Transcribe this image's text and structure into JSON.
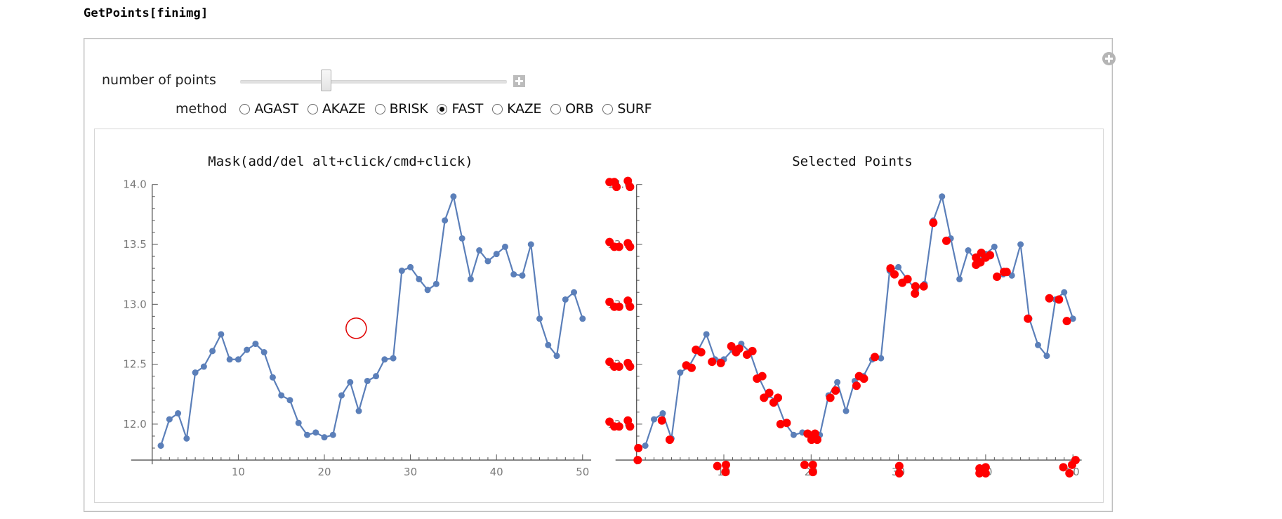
{
  "input_expression": "GetPoints[finimg]",
  "controls": {
    "slider": {
      "label": "number of points",
      "value_fraction": 0.32
    },
    "method": {
      "label": "method",
      "options": [
        "AGAST",
        "AKAZE",
        "BRISK",
        "FAST",
        "KAZE",
        "ORB",
        "SURF"
      ],
      "selected": "FAST"
    }
  },
  "icons": {
    "panel_corner": "plus-circle-icon",
    "slider_expand": "plus-square-icon"
  },
  "colors": {
    "series": "#5b7fb9",
    "selected_points": "#ff0000",
    "mask_circle": "#e00000",
    "axis": "#555555",
    "panel_border": "#bdbdbd"
  },
  "chart_data": [
    {
      "type": "line",
      "title": "Mask(add/del alt+click/cmd+click)",
      "xlabel": "",
      "ylabel": "",
      "xlim": [
        0,
        51
      ],
      "ylim": [
        11.7,
        14.0
      ],
      "x_ticks": [
        10,
        20,
        30,
        40,
        50
      ],
      "y_ticks": [
        "12.0",
        "12.5",
        "13.0",
        "13.5",
        "14.0"
      ],
      "grid": false,
      "x": [
        1,
        2,
        3,
        4,
        5,
        6,
        7,
        8,
        9,
        10,
        11,
        12,
        13,
        14,
        15,
        16,
        17,
        18,
        19,
        20,
        21,
        22,
        23,
        24,
        25,
        26,
        27,
        28,
        29,
        30,
        31,
        32,
        33,
        34,
        35,
        36,
        37,
        38,
        39,
        40,
        41,
        42,
        43,
        44,
        45,
        46,
        47,
        48,
        49,
        50
      ],
      "values": [
        11.82,
        12.04,
        12.09,
        11.88,
        12.43,
        12.48,
        12.61,
        12.75,
        12.54,
        12.54,
        12.62,
        12.67,
        12.6,
        12.39,
        12.24,
        12.2,
        12.01,
        11.91,
        11.93,
        11.89,
        11.91,
        12.24,
        12.35,
        12.11,
        12.36,
        12.4,
        12.54,
        12.55,
        13.28,
        13.31,
        13.21,
        13.12,
        13.17,
        13.7,
        13.9,
        13.55,
        13.21,
        13.45,
        13.36,
        13.42,
        13.48,
        13.25,
        13.24,
        13.5,
        12.88,
        12.66,
        12.57,
        13.04,
        13.1,
        12.88
      ],
      "mask_circles": [
        {
          "x": 23.7,
          "y": 12.8
        }
      ]
    },
    {
      "type": "scatter",
      "title": "Selected Points",
      "xlabel": "",
      "ylabel": "",
      "xlim": [
        0,
        51
      ],
      "ylim": [
        11.7,
        14.0
      ],
      "x_ticks": [
        10,
        20,
        30,
        40,
        50
      ],
      "y_ticks": [
        "12.0",
        "12.5",
        "13.0",
        "13.5",
        "14.0"
      ],
      "grid": false,
      "base_series": "same as Mask plot",
      "points": [
        [
          0.2,
          11.8
        ],
        [
          0.13,
          11.7
        ],
        [
          2.9,
          12.03
        ],
        [
          3.8,
          11.87
        ],
        [
          5.7,
          12.49
        ],
        [
          6.3,
          12.47
        ],
        [
          6.8,
          12.62
        ],
        [
          7.4,
          12.6
        ],
        [
          8.65,
          12.52
        ],
        [
          9.65,
          12.51
        ],
        [
          10.86,
          12.65
        ],
        [
          11.4,
          12.6
        ],
        [
          11.75,
          12.63
        ],
        [
          12.65,
          12.58
        ],
        [
          13.27,
          12.61
        ],
        [
          13.8,
          12.38
        ],
        [
          14.4,
          12.4
        ],
        [
          14.6,
          12.22
        ],
        [
          15.2,
          12.26
        ],
        [
          15.7,
          12.18
        ],
        [
          16.2,
          12.22
        ],
        [
          16.5,
          12.0
        ],
        [
          17.2,
          12.01
        ],
        [
          19.6,
          11.92
        ],
        [
          20.05,
          11.87
        ],
        [
          20.45,
          11.92
        ],
        [
          20.7,
          11.87
        ],
        [
          22.2,
          12.22
        ],
        [
          22.8,
          12.28
        ],
        [
          25.2,
          12.32
        ],
        [
          25.5,
          12.4
        ],
        [
          26.05,
          12.38
        ],
        [
          27.3,
          12.56
        ],
        [
          29.1,
          13.3
        ],
        [
          29.55,
          13.25
        ],
        [
          30.45,
          13.18
        ],
        [
          31.05,
          13.21
        ],
        [
          31.95,
          13.15
        ],
        [
          31.9,
          13.09
        ],
        [
          32.9,
          13.15
        ],
        [
          34.0,
          13.68
        ],
        [
          35.5,
          13.53
        ],
        [
          38.9,
          13.39
        ],
        [
          39.5,
          13.43
        ],
        [
          38.9,
          13.33
        ],
        [
          39.4,
          13.35
        ],
        [
          40.0,
          13.39
        ],
        [
          40.5,
          13.41
        ],
        [
          41.3,
          13.23
        ],
        [
          42.1,
          13.27
        ],
        [
          42.4,
          13.27
        ],
        [
          44.85,
          12.88
        ],
        [
          47.3,
          13.05
        ],
        [
          48.4,
          13.04
        ],
        [
          49.3,
          12.86
        ],
        [
          9.25,
          11.65
        ],
        [
          10.24,
          11.66
        ],
        [
          10.19,
          11.6
        ],
        [
          19.25,
          11.66
        ],
        [
          20.2,
          11.66
        ],
        [
          20.2,
          11.6
        ],
        [
          30.1,
          11.65
        ],
        [
          30.1,
          11.59
        ],
        [
          39.3,
          11.63
        ],
        [
          40.0,
          11.64
        ],
        [
          39.3,
          11.59
        ],
        [
          40.0,
          11.59
        ],
        [
          48.9,
          11.64
        ],
        [
          49.6,
          11.59
        ],
        [
          49.9,
          11.66
        ],
        [
          50.3,
          11.7
        ],
        [
          -3.1,
          14.02
        ],
        [
          -2.55,
          14.02
        ],
        [
          -2.3,
          13.98
        ],
        [
          -1.0,
          14.03
        ],
        [
          -0.75,
          13.98
        ],
        [
          -3.1,
          13.52
        ],
        [
          -2.55,
          13.48
        ],
        [
          -2.0,
          13.48
        ],
        [
          -1.0,
          13.51
        ],
        [
          -0.75,
          13.48
        ],
        [
          -3.1,
          13.02
        ],
        [
          -2.55,
          12.98
        ],
        [
          -2.0,
          12.98
        ],
        [
          -1.0,
          13.03
        ],
        [
          -0.75,
          12.98
        ],
        [
          -3.1,
          12.52
        ],
        [
          -2.55,
          12.48
        ],
        [
          -2.0,
          12.48
        ],
        [
          -1.0,
          12.51
        ],
        [
          -0.75,
          12.48
        ],
        [
          -3.1,
          12.02
        ],
        [
          -2.55,
          11.98
        ],
        [
          -2.0,
          11.98
        ],
        [
          -1.0,
          12.03
        ],
        [
          -0.75,
          11.98
        ]
      ]
    }
  ]
}
